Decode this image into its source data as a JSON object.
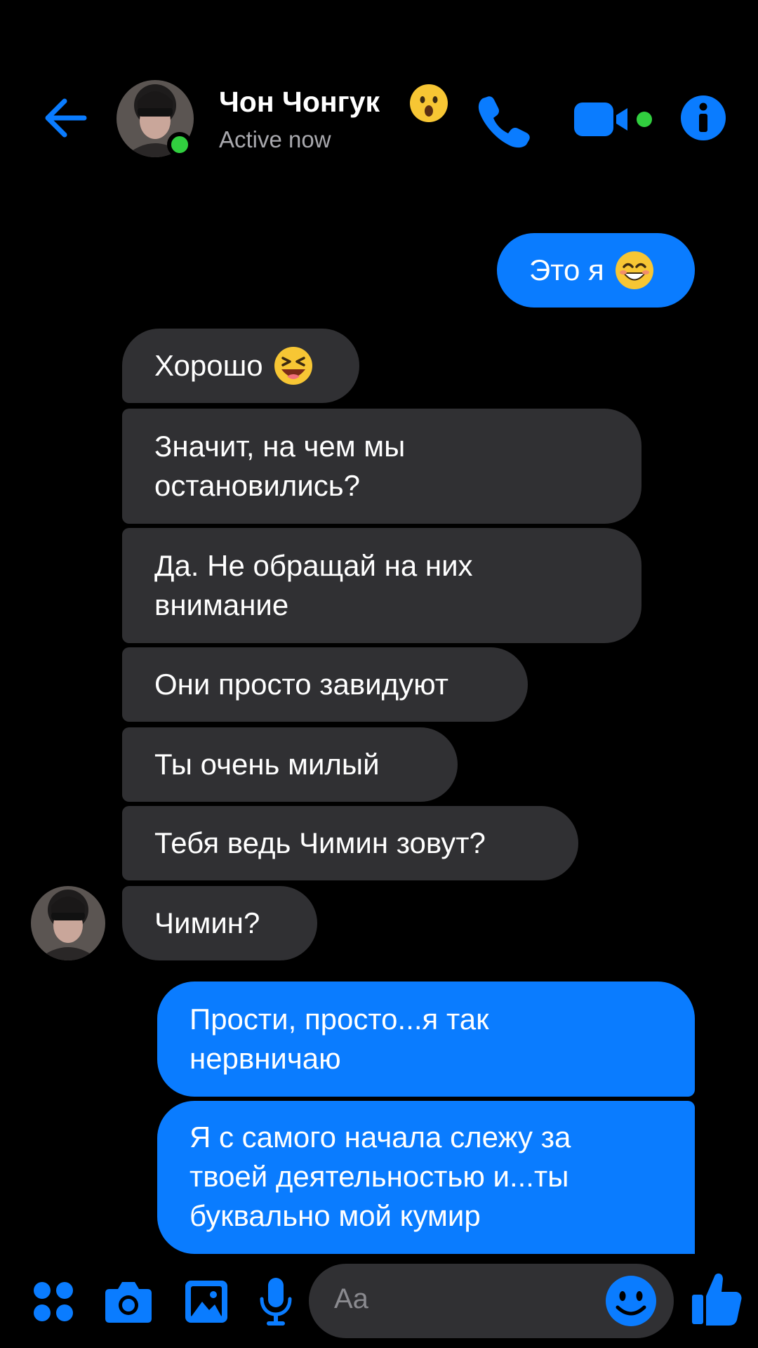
{
  "accent_color": "#0a7cff",
  "header": {
    "contact_name": "Чон Чонгук",
    "status": "Active now",
    "name_emoji": "hushed-face-emoji",
    "icons": [
      "back-arrow-icon",
      "phone-icon",
      "video-camera-icon",
      "info-icon"
    ]
  },
  "messages": [
    {
      "from": "me",
      "text": "Это я",
      "emoji": "smiling-face-emoji"
    },
    {
      "from": "contact",
      "text": "Хорошо",
      "emoji": "squinting-laughing-face-emoji"
    },
    {
      "from": "contact",
      "text": "Значит, на чем мы\nостановились?"
    },
    {
      "from": "contact",
      "text": "Да. Не обращай на них\nвнимание"
    },
    {
      "from": "contact",
      "text": "Они просто завидуют"
    },
    {
      "from": "contact",
      "text": "Ты очень милый"
    },
    {
      "from": "contact",
      "text": "Тебя ведь Чимин зовут?"
    },
    {
      "from": "contact",
      "text": "Чимин?"
    },
    {
      "from": "me",
      "text": "Прости, просто...я так\nнервничаю"
    },
    {
      "from": "me",
      "text": "Я с самого начала слежу за\nтвоей деятельностью и...ты\nбуквально мой кумир"
    }
  ],
  "composer": {
    "placeholder": "Aa",
    "icons": [
      "apps-icon",
      "camera-icon",
      "gallery-icon",
      "microphone-icon",
      "emoji-icon",
      "thumbs-up-icon"
    ]
  }
}
